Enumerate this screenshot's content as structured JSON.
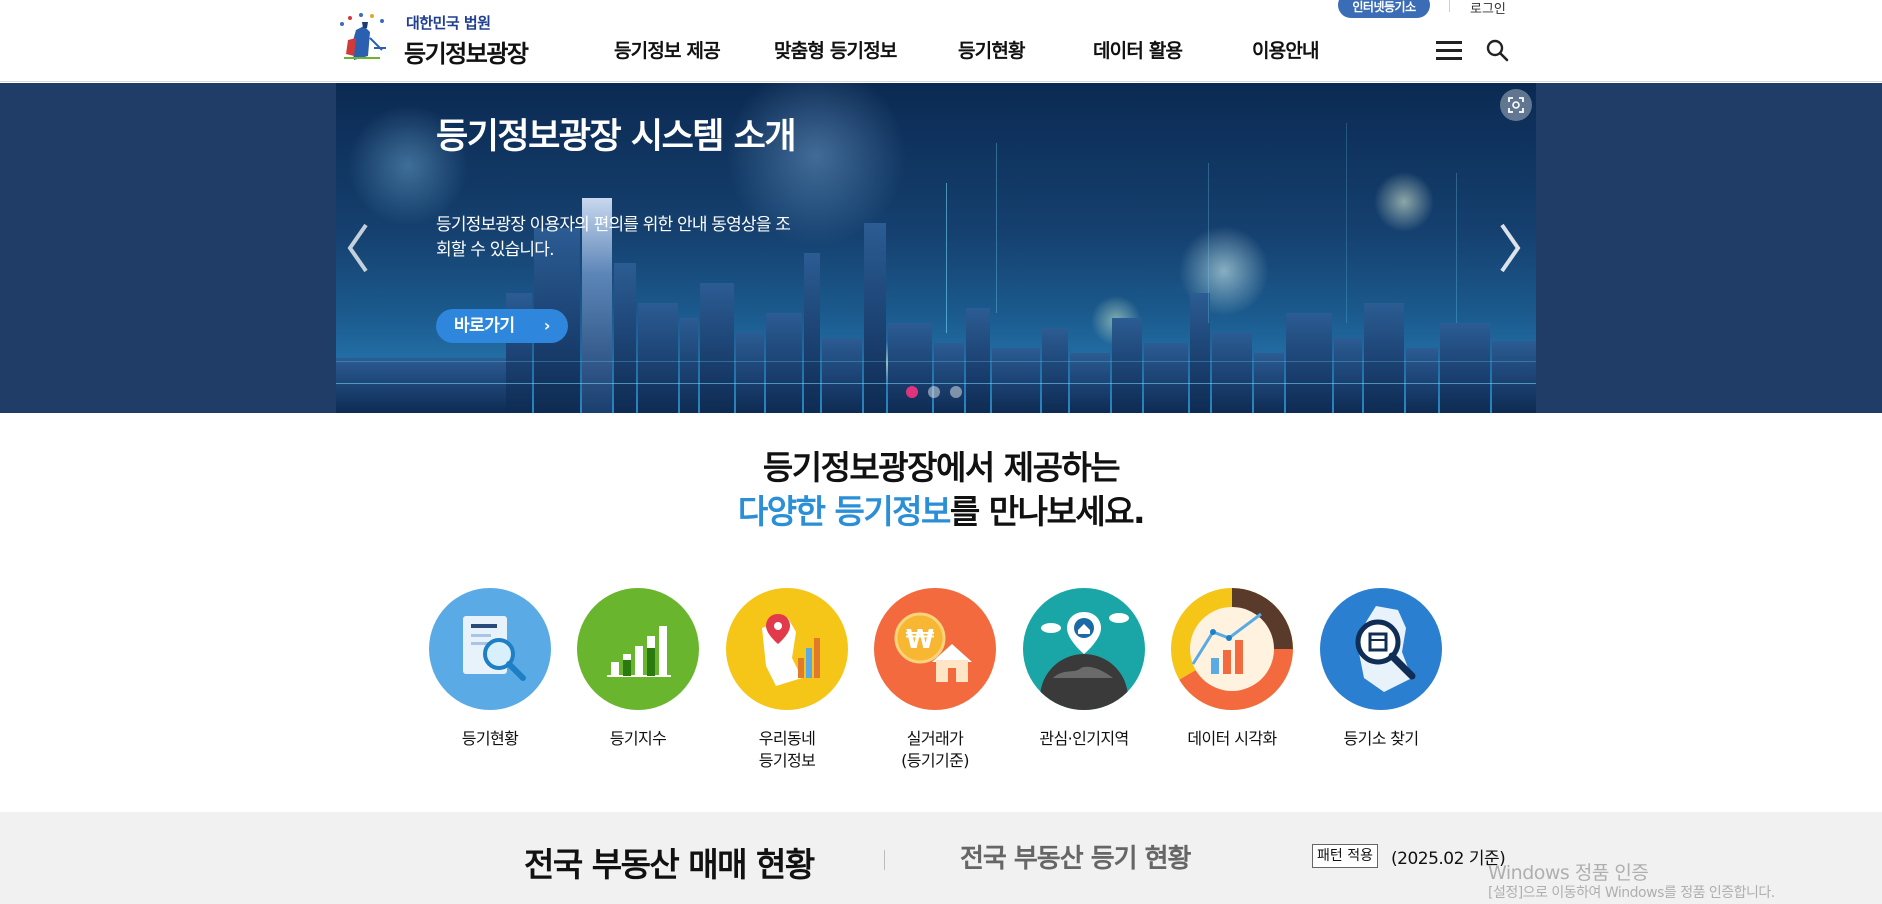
{
  "header": {
    "logo_sub": "대한민국 법원",
    "logo_main": "등기정보광장",
    "nav": [
      "등기정보 제공",
      "맞춤형 등기정보",
      "등기현황",
      "데이터 활용",
      "이용안내"
    ],
    "internet_registry_button": "인터넷등기소",
    "login_link": "로그인",
    "menu_icon": "hamburger-menu-icon",
    "search_icon": "search-icon"
  },
  "banner": {
    "title": "등기정보광장 시스템 소개",
    "description": "등기정보광장 이용자의 편의를 위한 안내 동영상을 조회할 수 있습니다.",
    "cta_label": "바로가기",
    "cta_icon": "chevron-right-icon",
    "active_slide": 1,
    "slide_count": 3,
    "accent_color": "#2f86dd",
    "active_dot_color": "#e0337e"
  },
  "intro": {
    "line1": "등기정보광장에서 제공하는",
    "line2_highlight": "다양한 등기정보",
    "line2_rest": "를 만나보세요.",
    "highlight_color": "#2b8fd8"
  },
  "services": [
    {
      "label": "등기현황",
      "icon": "document-search-icon",
      "color": "#5aabe5"
    },
    {
      "label": "등기지수",
      "icon": "bar-chart-icon",
      "color": "#6ab52e"
    },
    {
      "label": "우리동네\n등기정보",
      "icon": "map-pin-icon",
      "color": "#f5c518"
    },
    {
      "label": "실거래가\n(등기기준)",
      "icon": "won-house-icon",
      "color": "#f26a3d"
    },
    {
      "label": "관심·인기지역",
      "icon": "globe-home-icon",
      "color": "#1aa6a6"
    },
    {
      "label": "데이터 시각화",
      "icon": "donut-chart-icon",
      "color": "#f5c518"
    },
    {
      "label": "등기소 찾기",
      "icon": "registry-search-icon",
      "color": "#2a7fd0"
    }
  ],
  "stats": {
    "tab_active": "전국 부동산 매매 현황",
    "tab_inactive": "전국 부동산 등기 현황",
    "pattern_badge": "패턴 적용",
    "date": "(2025.02 기준)"
  },
  "watermark": {
    "line1": "Windows 정품 인증",
    "line2": "[설정]으로 이동하여 Windows를 정품 인증합니다."
  }
}
